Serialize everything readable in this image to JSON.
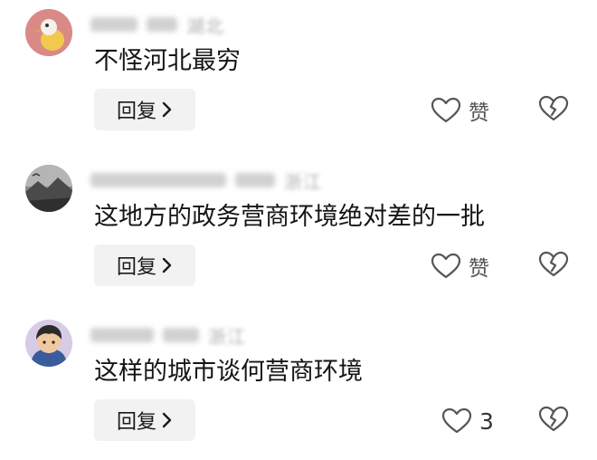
{
  "comments": [
    {
      "region": "湖北",
      "text": "不怪河北最穷",
      "reply_label": "回复",
      "like_label": "赞",
      "avatar_icon": "bird-avatar-icon"
    },
    {
      "region": "浙江",
      "text": "这地方的政务营商环境绝对差的一批",
      "reply_label": "回复",
      "like_label": "赞",
      "avatar_icon": "landscape-avatar-icon"
    },
    {
      "region": "浙江",
      "text": "这样的城市谈何营商环境",
      "reply_label": "回复",
      "like_label": "3",
      "avatar_icon": "cartoon-avatar-icon"
    }
  ],
  "colors": {
    "reply_bg": "#f2f2f2",
    "text": "#151515",
    "muted": "#555555"
  }
}
